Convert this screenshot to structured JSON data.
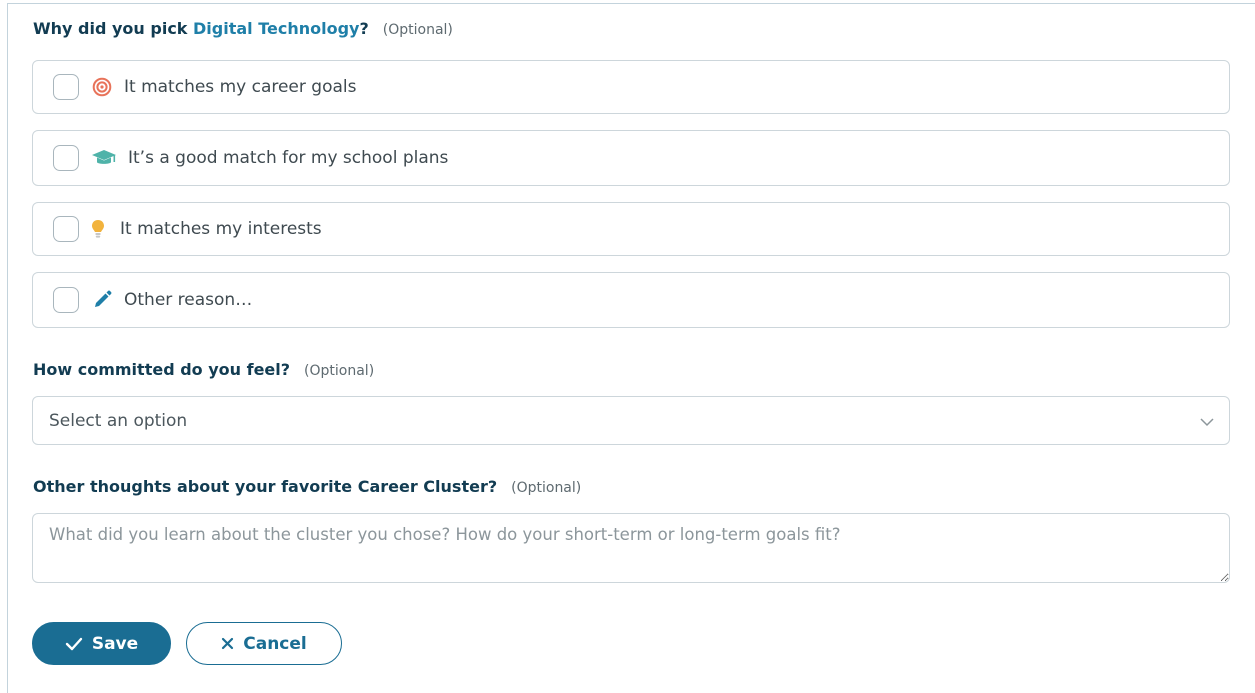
{
  "q1": {
    "prefix": "Why did you pick ",
    "highlight": "Digital Technology",
    "suffix": "?",
    "optional": "(Optional)"
  },
  "choices": [
    {
      "label": "It matches my career goals",
      "icon": "target-icon",
      "checked": false
    },
    {
      "label": "It’s a good match for my school plans",
      "icon": "graduation-cap-icon",
      "checked": false
    },
    {
      "label": "It matches my interests",
      "icon": "lightbulb-icon",
      "checked": false
    },
    {
      "label": "Other reason…",
      "icon": "pencil-icon",
      "checked": false
    }
  ],
  "q2": {
    "label": "How committed do you feel?",
    "optional": "(Optional)",
    "selected": "Select an option"
  },
  "q3": {
    "label": "Other thoughts about your favorite Career Cluster?",
    "optional": "(Optional)",
    "placeholder": "What did you learn about the cluster you chose? How do your short-term or long-term goals fit?"
  },
  "buttons": {
    "save": "Save",
    "cancel": "Cancel"
  },
  "colors": {
    "heading": "#123c52",
    "accent": "#1f7fa8",
    "primary_button": "#1a6d93",
    "target_icon": "#e8735a",
    "cap_icon": "#4fb3a9",
    "bulb_icon": "#f2b33d",
    "pencil_icon": "#1f7fa8"
  }
}
